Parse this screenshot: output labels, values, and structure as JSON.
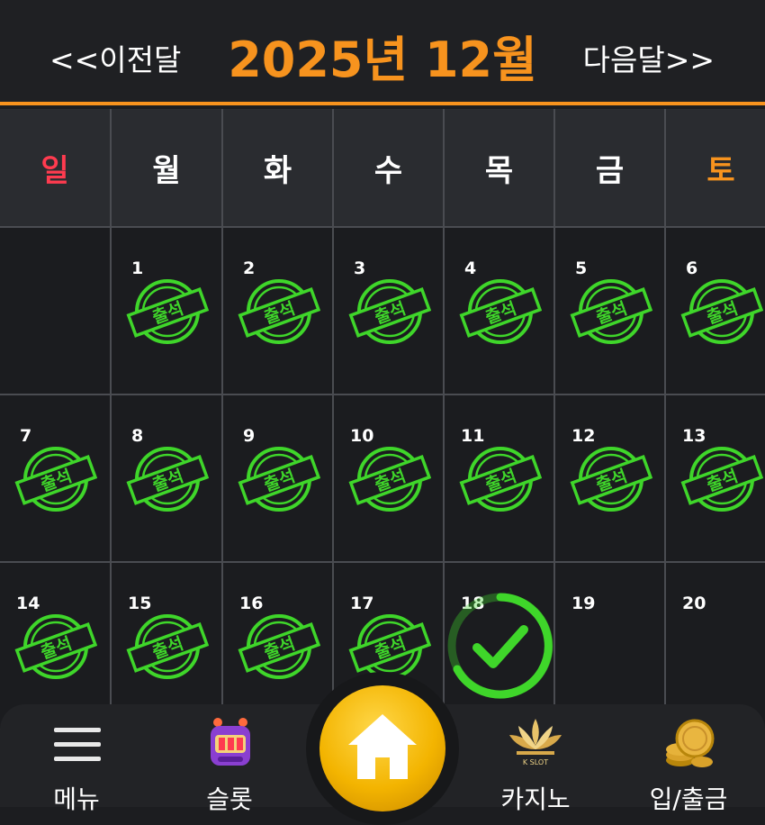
{
  "header": {
    "prev_label": "<<이전달",
    "title": "2025년 12월",
    "next_label": "다음달>>",
    "accent_color": "#f7931e"
  },
  "weekdays": [
    "일",
    "월",
    "화",
    "수",
    "목",
    "금",
    "토"
  ],
  "weeks": [
    [
      "",
      "1",
      "2",
      "3",
      "4",
      "5",
      "6"
    ],
    [
      "7",
      "8",
      "9",
      "10",
      "11",
      "12",
      "13"
    ],
    [
      "14",
      "15",
      "16",
      "17",
      "18",
      "19",
      "20"
    ]
  ],
  "stamp_text": "출석",
  "stamp_color": "#3fd62a",
  "attended_days": [
    1,
    2,
    3,
    4,
    5,
    6,
    7,
    8,
    9,
    10,
    11,
    12,
    13,
    14,
    15,
    16,
    17
  ],
  "today": 18,
  "nav": {
    "menu_label": "메뉴",
    "slot_label": "슬롯",
    "casino_label": "카지노",
    "casino_logo_text": "K SLOT",
    "bank_label": "입/출금"
  },
  "icons": {
    "menu": "hamburger-icon",
    "slot": "slot-machine-icon",
    "home": "home-icon",
    "casino": "lotus-logo-icon",
    "bank": "coins-icon"
  }
}
